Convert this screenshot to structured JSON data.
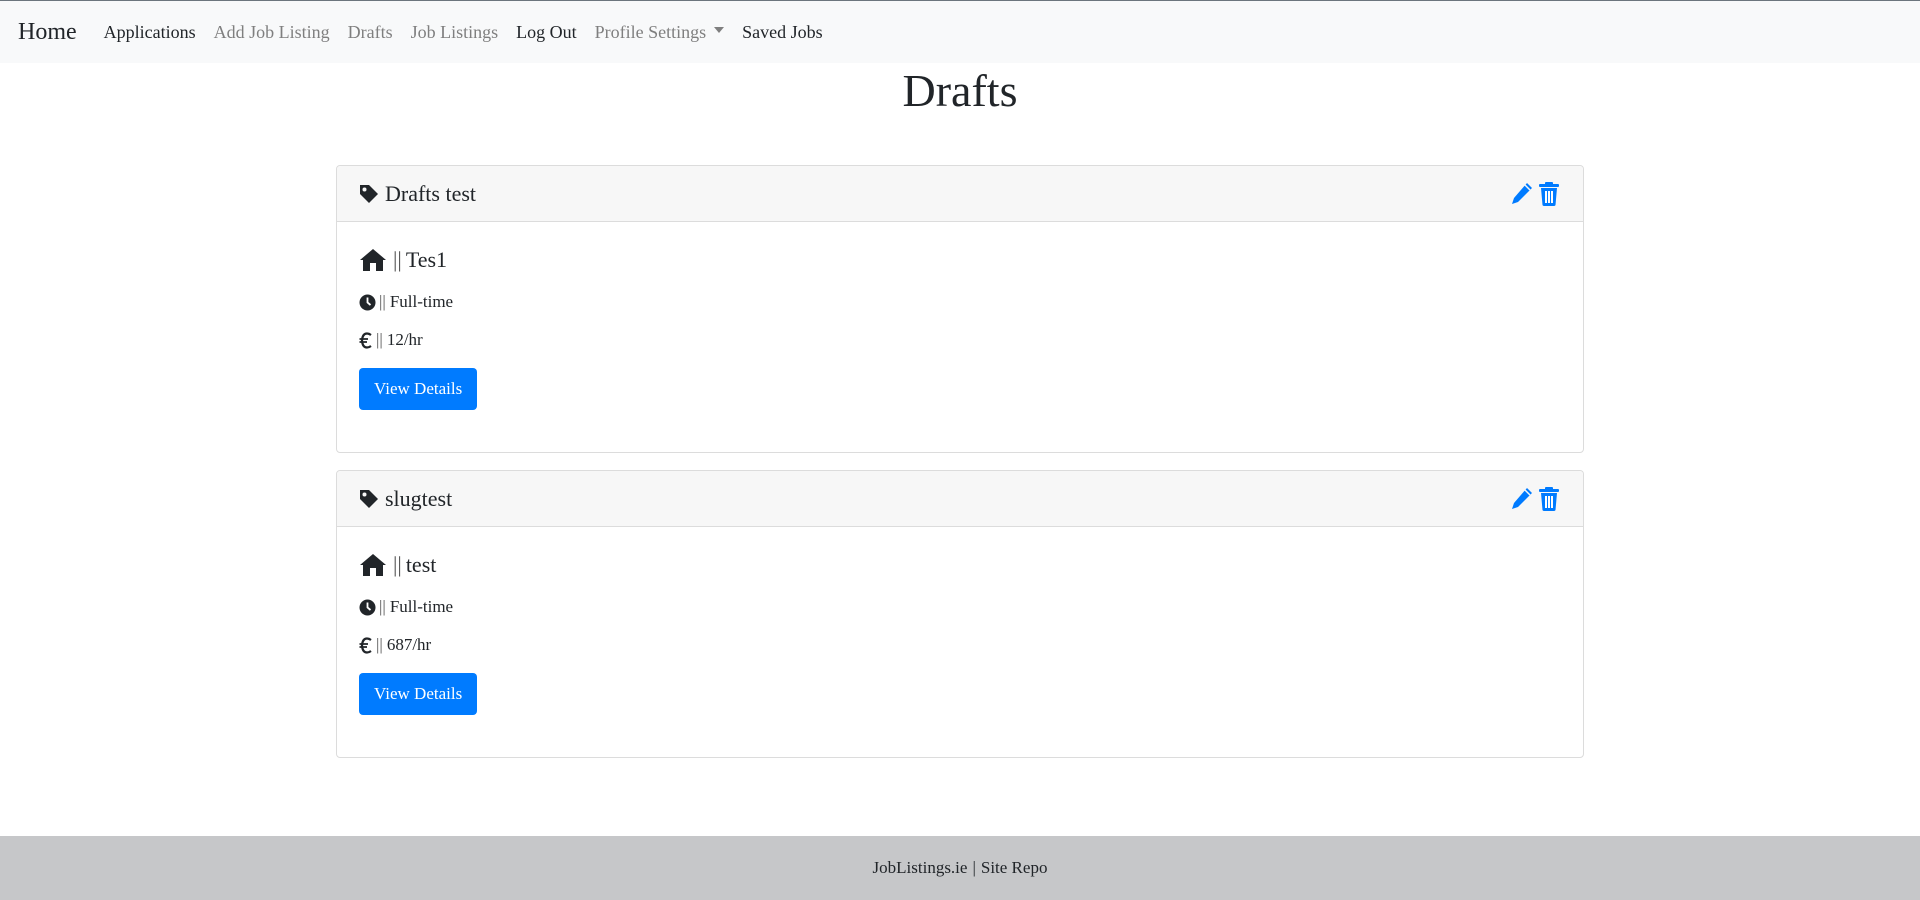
{
  "navbar": {
    "brand": "Home",
    "links": [
      {
        "label": "Applications",
        "style": "dark"
      },
      {
        "label": "Add Job Listing",
        "style": "muted"
      },
      {
        "label": "Drafts",
        "style": "muted"
      },
      {
        "label": "Job Listings",
        "style": "muted"
      },
      {
        "label": "Log Out",
        "style": "dark"
      },
      {
        "label": "Profile Settings",
        "style": "muted",
        "dropdown": true
      },
      {
        "label": "Saved Jobs",
        "style": "dark"
      }
    ]
  },
  "page": {
    "title": "Drafts"
  },
  "drafts": [
    {
      "title": "Drafts test",
      "separator": "||",
      "location": "Tes1",
      "job_type": "Full-time",
      "pay": "12/hr",
      "button_label": "View Details"
    },
    {
      "title": "slugtest",
      "separator": "||",
      "location": "test",
      "job_type": "Full-time",
      "pay": "687/hr",
      "button_label": "View Details"
    }
  ],
  "icons": {
    "title": "tag-icon",
    "location": "home-icon",
    "job_type": "clock-icon",
    "pay": "euro-icon",
    "edit": "pencil-icon",
    "delete": "trash-icon"
  },
  "footer": {
    "site": "JobListings.ie",
    "divider": "|",
    "repo": "Site Repo"
  },
  "colors": {
    "accent": "#007bff",
    "navbar_bg": "#f8f9fa",
    "footer_bg": "#c6c7c9",
    "card_header_bg": "#f7f7f7"
  }
}
